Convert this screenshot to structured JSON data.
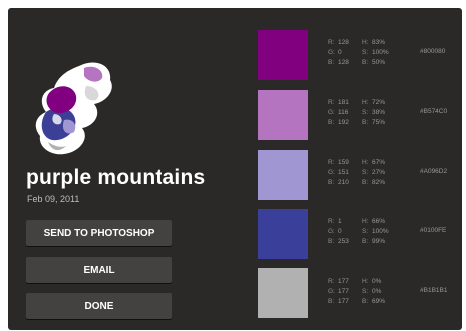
{
  "artwork": {
    "name": "purple mountains",
    "date": "Feb 09, 2011"
  },
  "buttons": {
    "send_to_photoshop": "SEND TO PHOTOSHOP",
    "email": "EMAIL",
    "done": "DONE"
  },
  "labels": {
    "r": "R:",
    "g": "G:",
    "b": "B:",
    "h": "H:",
    "s": "S:",
    "br": "B:"
  },
  "colors": [
    {
      "r": "128",
      "g": "0",
      "b": "128",
      "h": "83%",
      "s": "100%",
      "br": "50%",
      "hex": "#800080",
      "swatch": "#800080"
    },
    {
      "r": "181",
      "g": "116",
      "b": "192",
      "h": "72%",
      "s": "38%",
      "br": "75%",
      "hex": "#B574C0",
      "swatch": "#b574c0"
    },
    {
      "r": "159",
      "g": "151",
      "b": "210",
      "h": "67%",
      "s": "27%",
      "br": "82%",
      "hex": "#A096D2",
      "swatch": "#a097d2"
    },
    {
      "r": "1",
      "g": "0",
      "b": "253",
      "h": "66%",
      "s": "100%",
      "br": "99%",
      "hex": "#0100FE",
      "swatch": "#3a3f9a"
    },
    {
      "r": "177",
      "g": "177",
      "b": "177",
      "h": "0%",
      "s": "0%",
      "br": "69%",
      "hex": "#B1B1B1",
      "swatch": "#b1b1b1"
    }
  ]
}
